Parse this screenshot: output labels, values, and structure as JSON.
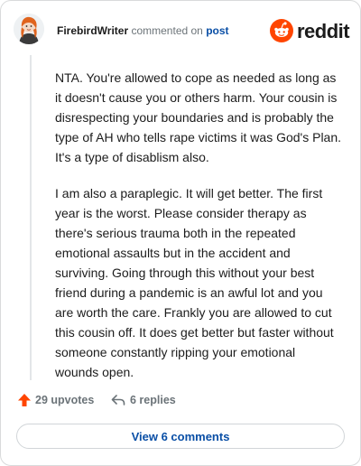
{
  "header": {
    "username": "FirebirdWriter",
    "commented_text": "commented on",
    "post_link": "post",
    "brand": "reddit"
  },
  "comment": {
    "paragraphs": [
      "NTA. You're allowed to cope as needed as long as it doesn't cause you or others harm. Your cousin is disrespecting your boundaries and is probably the type of AH who tells rape victims it was God's Plan. It's a type of disablism also.",
      "I am also a paraplegic. It will get better. The first year is the worst. Please consider therapy as there's serious trauma both in the repeated emotional assaults but in the accident and surviving. Going through this without your best friend during a pandemic is an awful lot and you are worth the care. Frankly you are allowed to cut this cousin off. It does get better but faster without someone constantly ripping your emotional wounds open."
    ]
  },
  "actions": {
    "upvotes": "29 upvotes",
    "replies": "6 replies"
  },
  "footer": {
    "view_button": "View 6 comments"
  },
  "colors": {
    "brand_orange": "#ff4500",
    "link_blue": "#0a4fa6",
    "muted_gray": "#6b7378"
  },
  "icons": {
    "avatar": "user-avatar",
    "brand": "reddit-snoo-icon",
    "upvote": "upvote-arrow-icon",
    "reply": "reply-arrow-icon"
  }
}
